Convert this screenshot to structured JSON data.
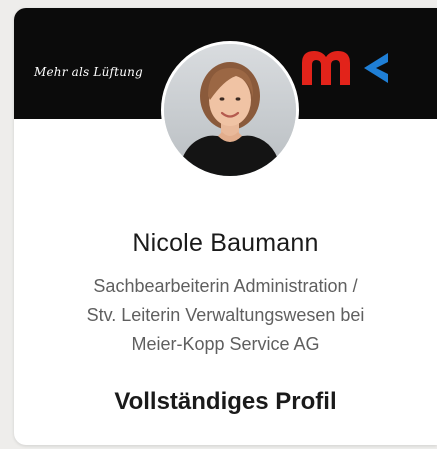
{
  "banner": {
    "slogan": "Mehr als Lüftung",
    "logo_alt": "MK",
    "background_color": "#0b0b0b",
    "logo_colors": {
      "m": "#e2231a",
      "k": "#1f7fd6"
    }
  },
  "profile": {
    "name": "Nicole Baumann",
    "headline_lines": [
      "Sachbearbeiterin Administration /",
      "Stv. Leiterin Verwaltungswesen bei",
      "Meier-Kopp Service AG"
    ],
    "link_label": "Vollständiges Profil"
  }
}
